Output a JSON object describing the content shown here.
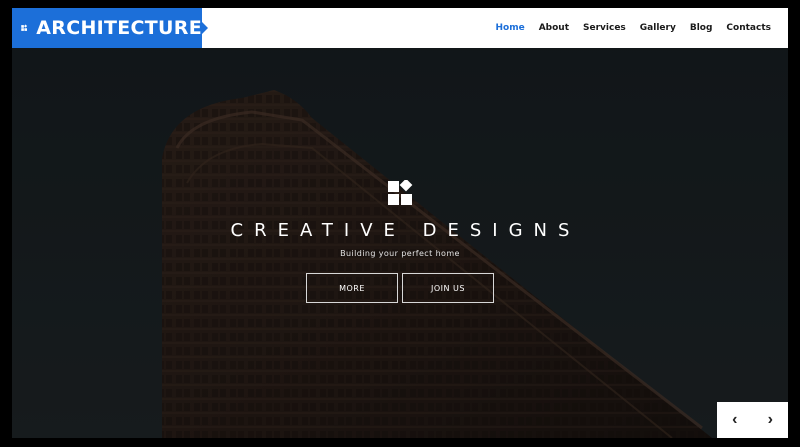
{
  "brand": {
    "name": "ARCHITECTURE",
    "color": "#1c6fd9"
  },
  "nav": {
    "items": [
      {
        "label": "Home",
        "active": true
      },
      {
        "label": "About",
        "active": false
      },
      {
        "label": "Services",
        "active": false
      },
      {
        "label": "Gallery",
        "active": false
      },
      {
        "label": "Blog",
        "active": false
      },
      {
        "label": "Contacts",
        "active": false
      }
    ]
  },
  "hero": {
    "icon": "logo-blocks-icon",
    "title": "CREATIVE DESIGNS",
    "subtitle": "Building your perfect home",
    "buttons": {
      "more": "MORE",
      "join": "JOIN US"
    }
  },
  "slider": {
    "prev": "‹",
    "next": "›"
  }
}
